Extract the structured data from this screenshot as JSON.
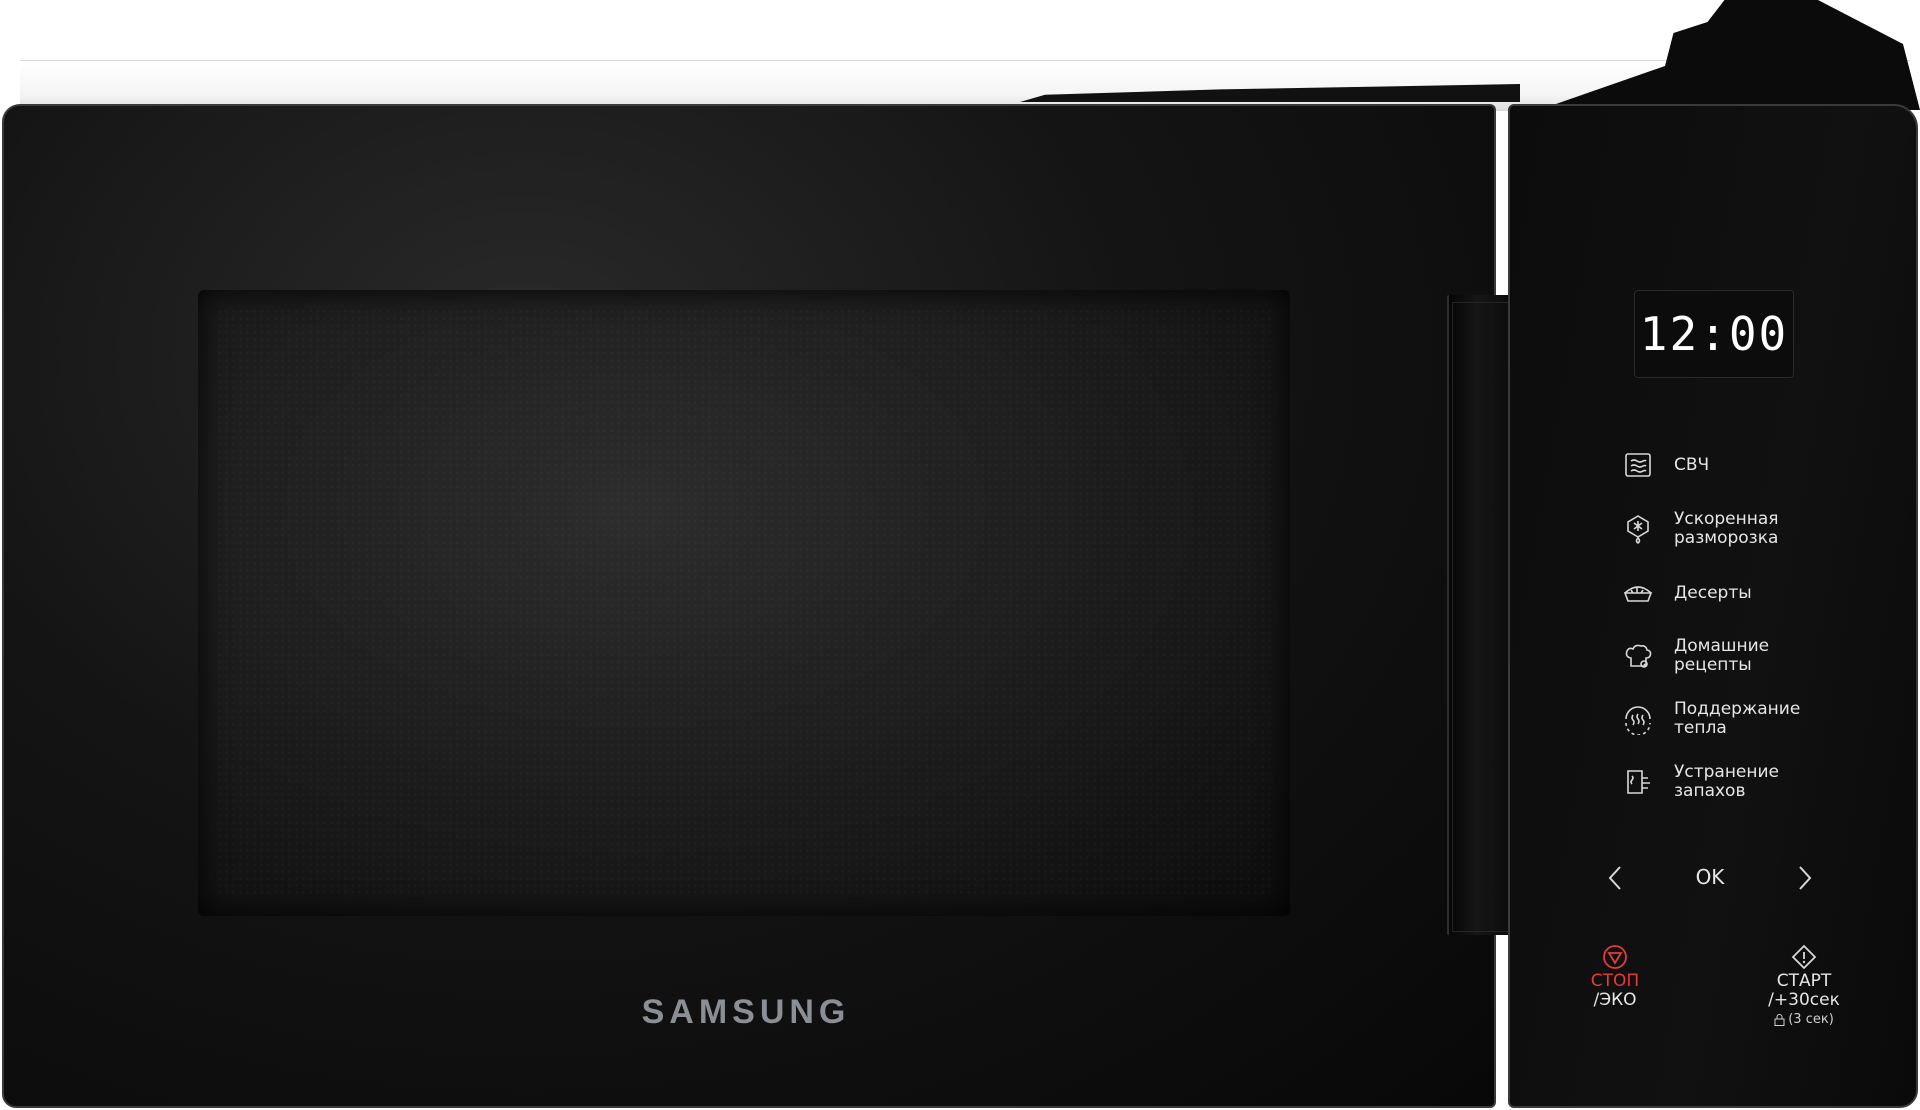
{
  "brand": "SAMSUNG",
  "display": {
    "time": "12:00"
  },
  "menu": [
    {
      "icon": "microwave-waves-icon",
      "line1": "СВЧ",
      "line2": ""
    },
    {
      "icon": "defrost-icon",
      "line1": "Ускоренная",
      "line2": "разморозка"
    },
    {
      "icon": "dessert-pie-icon",
      "line1": "Десерты",
      "line2": ""
    },
    {
      "icon": "chef-hat-icon",
      "line1": "Домашние",
      "line2": "рецепты"
    },
    {
      "icon": "keep-warm-icon",
      "line1": "Поддержание",
      "line2": "тепла"
    },
    {
      "icon": "deodorize-icon",
      "line1": "Устранение",
      "line2": "запахов"
    }
  ],
  "nav": {
    "left": "<",
    "ok": "OK",
    "right": ">"
  },
  "stop": {
    "line1": "СТОП",
    "line2": "/ЭКО",
    "color": "#e43b3b"
  },
  "start": {
    "line1": "СТАРТ",
    "line2": "/+30сек",
    "lock_hint": "(3 сек)"
  }
}
